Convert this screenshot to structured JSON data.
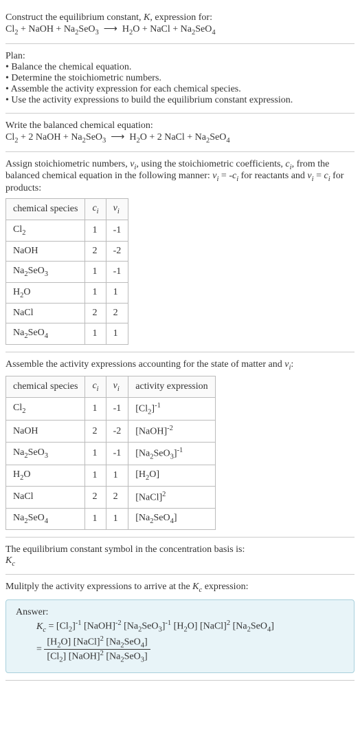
{
  "sec1": {
    "line1": "Construct the equilibrium constant, K, expression for:",
    "line2": "Cl₂ + NaOH + Na₂SeO₃ ⟶ H₂O + NaCl + Na₂SeO₄"
  },
  "sec2": {
    "title": "Plan:",
    "b1": "• Balance the chemical equation.",
    "b2": "• Determine the stoichiometric numbers.",
    "b3": "• Assemble the activity expression for each chemical species.",
    "b4": "• Use the activity expressions to build the equilibrium constant expression."
  },
  "sec3": {
    "line1": "Write the balanced chemical equation:",
    "line2": "Cl₂ + 2 NaOH + Na₂SeO₃ ⟶ H₂O + 2 NaCl + Na₂SeO₄"
  },
  "sec4": {
    "intro": "Assign stoichiometric numbers, νᵢ, using the stoichiometric coefficients, cᵢ, from the balanced chemical equation in the following manner: νᵢ = -cᵢ for reactants and νᵢ = cᵢ for products:",
    "header": {
      "h1": "chemical species",
      "h2": "cᵢ",
      "h3": "νᵢ"
    },
    "rows": [
      {
        "s": "Cl₂",
        "c": "1",
        "v": "-1"
      },
      {
        "s": "NaOH",
        "c": "2",
        "v": "-2"
      },
      {
        "s": "Na₂SeO₃",
        "c": "1",
        "v": "-1"
      },
      {
        "s": "H₂O",
        "c": "1",
        "v": "1"
      },
      {
        "s": "NaCl",
        "c": "2",
        "v": "2"
      },
      {
        "s": "Na₂SeO₄",
        "c": "1",
        "v": "1"
      }
    ]
  },
  "sec5": {
    "intro": "Assemble the activity expressions accounting for the state of matter and νᵢ:",
    "header": {
      "h1": "chemical species",
      "h2": "cᵢ",
      "h3": "νᵢ",
      "h4": "activity expression"
    },
    "rows": [
      {
        "s": "Cl₂",
        "c": "1",
        "v": "-1",
        "a": "[Cl₂]⁻¹"
      },
      {
        "s": "NaOH",
        "c": "2",
        "v": "-2",
        "a": "[NaOH]⁻²"
      },
      {
        "s": "Na₂SeO₃",
        "c": "1",
        "v": "-1",
        "a": "[Na₂SeO₃]⁻¹"
      },
      {
        "s": "H₂O",
        "c": "1",
        "v": "1",
        "a": "[H₂O]"
      },
      {
        "s": "NaCl",
        "c": "2",
        "v": "2",
        "a": "[NaCl]²"
      },
      {
        "s": "Na₂SeO₄",
        "c": "1",
        "v": "1",
        "a": "[Na₂SeO₄]"
      }
    ]
  },
  "sec6": {
    "line1": "The equilibrium constant symbol in the concentration basis is:",
    "line2": "K𝒸"
  },
  "sec7": {
    "intro": "Mulitply the activity expressions to arrive at the K𝒸 expression:",
    "answerLabel": "Answer:",
    "eq1": "K𝒸 = [Cl₂]⁻¹ [NaOH]⁻² [Na₂SeO₃]⁻¹ [H₂O] [NaCl]² [Na₂SeO₄]",
    "eq2pre": "= ",
    "eq2num": "[H₂O] [NaCl]² [Na₂SeO₄]",
    "eq2den": "[Cl₂] [NaOH]² [Na₂SeO₃]"
  }
}
